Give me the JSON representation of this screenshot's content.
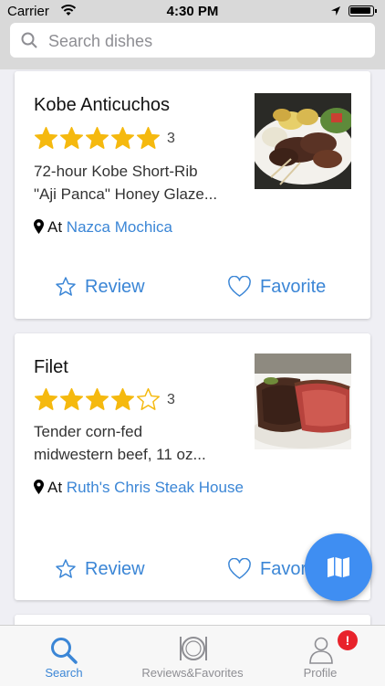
{
  "status_bar": {
    "carrier": "Carrier",
    "time": "4:30 PM"
  },
  "search": {
    "placeholder": "Search dishes",
    "value": ""
  },
  "dishes": [
    {
      "name": "Kobe Anticuchos",
      "rating": 5,
      "rating_count": "3",
      "description_line1": "72-hour Kobe Short-Rib",
      "description_line2": "\"Aji Panca\" Honey Glaze...",
      "location_prefix": "At",
      "restaurant": "Nazca Mochica",
      "review_label": "Review",
      "favorite_label": "Favorite"
    },
    {
      "name": "Filet",
      "rating": 4,
      "rating_count": "3",
      "description_line1": "Tender corn-fed",
      "description_line2": "midwestern beef, 11 oz...",
      "location_prefix": "At",
      "restaurant": "Ruth's Chris Steak House",
      "review_label": "Review",
      "favorite_label": "Favorite"
    }
  ],
  "tabs": [
    {
      "label": "Search",
      "active": true,
      "icon": "magnifier-icon"
    },
    {
      "label": "Reviews&Favorites",
      "active": false,
      "icon": "plate-icon"
    },
    {
      "label": "Profile",
      "active": false,
      "icon": "person-icon",
      "badge": "!"
    }
  ],
  "colors": {
    "accent": "#3b86d6",
    "star": "#f5b90f",
    "fab": "#3f8ef2",
    "badge": "#e8232b"
  }
}
